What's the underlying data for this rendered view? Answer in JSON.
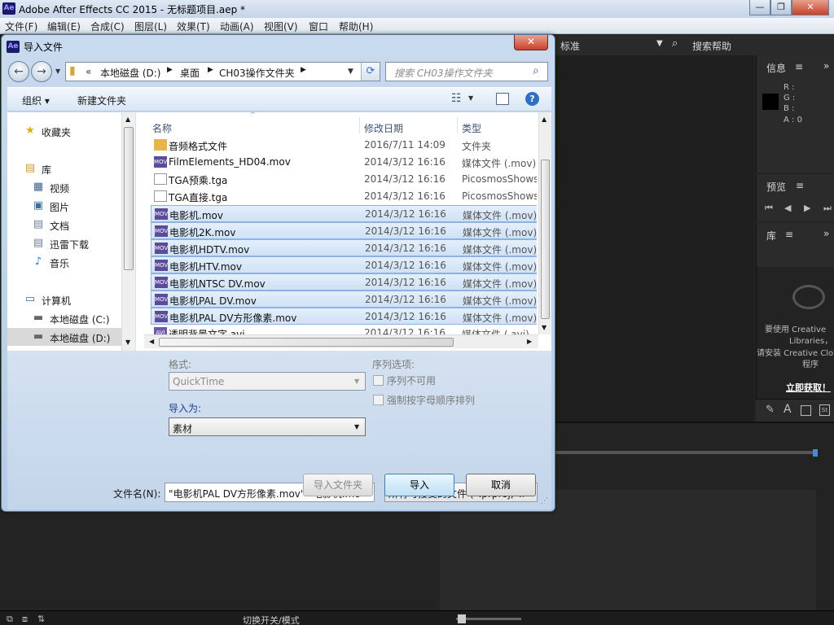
{
  "app": {
    "title": "Adobe After Effects CC 2015 - 无标题项目.aep *",
    "logo": "Ae",
    "menu": [
      "文件(F)",
      "编辑(E)",
      "合成(C)",
      "图层(L)",
      "效果(T)",
      "动画(A)",
      "视图(V)",
      "窗口",
      "帮助(H)"
    ],
    "window_buttons": {
      "minimize": "—",
      "restore": "❐",
      "close": "✕"
    }
  },
  "workspace": {
    "label": "标准",
    "search_help": "搜索帮助"
  },
  "panels": {
    "info": {
      "title": "信息",
      "menu": "≡",
      "r": "R :",
      "g": "G :",
      "b": "B :",
      "a": "A : 0"
    },
    "preview": {
      "title": "预览",
      "menu": "≡"
    },
    "library": {
      "title": "库",
      "menu": "≡",
      "message": "要使用 Creative Libraries，请安装 Creative Cloud 程序",
      "line1": "要使用 Creative",
      "line2": "Libraries，",
      "line3": "请安装 Creative Clo",
      "line4": "程序",
      "install": "立即获取！"
    },
    "timeline": {
      "toggle_label": "切换开关/模式"
    }
  },
  "dialog": {
    "title": "导入文件",
    "icon": "Ae",
    "close": "✕",
    "address": {
      "chevrons": "«",
      "parts": [
        "本地磁盘 (D:)",
        "桌面",
        "CH03操作文件夹"
      ]
    },
    "search_placeholder": "搜索 CH03操作文件夹",
    "toolbar": {
      "organize": "组织 ▾",
      "new_folder": "新建文件夹"
    },
    "nav": [
      {
        "label": "收藏夹",
        "icon": "★",
        "color": "#e8b400"
      },
      {
        "label": "库",
        "icon": "▤",
        "color": "#d8a640"
      },
      {
        "label": "视频",
        "icon": "▦",
        "color": "#3f5f88"
      },
      {
        "label": "图片",
        "icon": "▣",
        "color": "#3f6f98"
      },
      {
        "label": "文档",
        "icon": "▤",
        "color": "#6d7f96"
      },
      {
        "label": "迅雷下载",
        "icon": "▤",
        "color": "#6d7f96"
      },
      {
        "label": "音乐",
        "icon": "♪",
        "color": "#2b73c8"
      },
      {
        "label": "计算机",
        "icon": "▭",
        "color": "#3f6aa0"
      },
      {
        "label": "本地磁盘 (C:)",
        "icon": "▬",
        "color": "#666"
      },
      {
        "label": "本地磁盘 (D:)",
        "icon": "▬",
        "color": "#666"
      }
    ],
    "columns": {
      "name": "名称",
      "date": "修改日期",
      "type": "类型"
    },
    "files": [
      {
        "name": "音频格式文件",
        "date": "2016/7/11 14:09",
        "type": "文件夹",
        "icon": "folder",
        "selected": false
      },
      {
        "name": "FilmElements_HD04.mov",
        "date": "2014/3/12 16:16",
        "type": "媒体文件 (.mov)",
        "icon": "mov",
        "selected": false
      },
      {
        "name": "TGA预乘.tga",
        "date": "2014/3/12 16:16",
        "type": "PicosmosShows",
        "icon": "tga",
        "selected": false
      },
      {
        "name": "TGA直接.tga",
        "date": "2014/3/12 16:16",
        "type": "PicosmosShows",
        "icon": "tga",
        "selected": false
      },
      {
        "name": "电影机.mov",
        "date": "2014/3/12 16:16",
        "type": "媒体文件 (.mov)",
        "icon": "mov",
        "selected": true
      },
      {
        "name": "电影机2K.mov",
        "date": "2014/3/12 16:16",
        "type": "媒体文件 (.mov)",
        "icon": "mov",
        "selected": true
      },
      {
        "name": "电影机HDTV.mov",
        "date": "2014/3/12 16:16",
        "type": "媒体文件 (.mov)",
        "icon": "mov",
        "selected": true
      },
      {
        "name": "电影机HTV.mov",
        "date": "2014/3/12 16:16",
        "type": "媒体文件 (.mov)",
        "icon": "mov",
        "selected": true
      },
      {
        "name": "电影机NTSC DV.mov",
        "date": "2014/3/12 16:16",
        "type": "媒体文件 (.mov)",
        "icon": "mov",
        "selected": true
      },
      {
        "name": "电影机PAL DV.mov",
        "date": "2014/3/12 16:16",
        "type": "媒体文件 (.mov)",
        "icon": "mov",
        "selected": true
      },
      {
        "name": "电影机PAL DV方形像素.mov",
        "date": "2014/3/12 16:16",
        "type": "媒体文件 (.mov)",
        "icon": "mov",
        "selected": true
      },
      {
        "name": "透明背景文字.avi",
        "date": "2014/3/12 16:16",
        "type": "媒体文件 (.avi)",
        "icon": "avi",
        "selected": false
      }
    ],
    "format": {
      "label": "格式:",
      "value": "QuickTime"
    },
    "sequence": {
      "label": "序列选项:",
      "opt1": "序列不可用",
      "opt2": "强制按字母顺序排列"
    },
    "import_as": {
      "label": "导入为:",
      "value": "素材"
    },
    "filename": {
      "label": "文件名(N):",
      "value": "\"电影机PAL DV方形像素.mov\" \"电影机.mov"
    },
    "filetype": {
      "value": "所有可接受的文件 (*.prproj;*.a"
    },
    "buttons": {
      "import_folder": "导入文件夹",
      "import": "导入",
      "cancel": "取消"
    }
  }
}
